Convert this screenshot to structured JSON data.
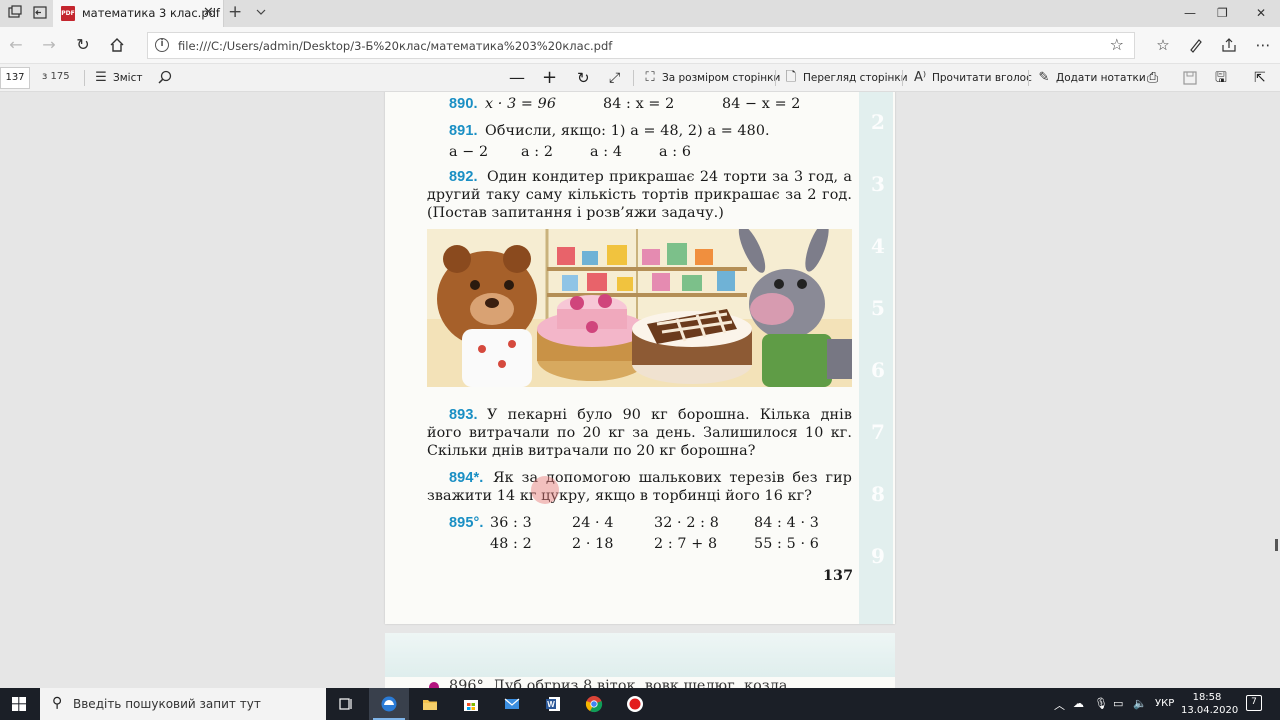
{
  "window": {
    "tab_title": "математика 3 клас.pdf",
    "pdf_badge": "PDF",
    "close_glyph": "✕",
    "new_tab_glyph": "+",
    "minimize_glyph": "—",
    "restore_glyph": "❐",
    "window_close_glyph": "✕"
  },
  "address_bar": {
    "url": "file:///C:/Users/admin/Desktop/3-Б%20клас/математика%203%20клас.pdf"
  },
  "pdf_toolbar": {
    "page_current": "137",
    "page_total": "з 175",
    "contents_label": "Зміст",
    "fit_label": "За розміром сторінки",
    "page_view_label": "Перегляд сторінки",
    "read_aloud_label": "Прочитати вголос",
    "add_notes_label": "Додати нотатки"
  },
  "page": {
    "p890_num": "890.",
    "p890_a": "x · 3 = 96",
    "p890_b": "84 : x = 2",
    "p890_c": "84 − x = 2",
    "p891_num": "891.",
    "p891_text": "Обчисли, якщо: 1) a = 48, 2) a = 480.",
    "p891_e1": "a − 2",
    "p891_e2": "a : 2",
    "p891_e3": "a : 4",
    "p891_e4": "a : 6",
    "p892_num": "892.",
    "p892_l1": "Один кондитер прикрашає 24 торти за 3 год, а",
    "p892_l2": "другий таку саму кількість тортів прикрашає за 2 год.",
    "p892_l3": "(Постав запитання і розв’яжи задачу.)",
    "p893_num": "893.",
    "p893_l1": "У пекарні було 90 кг борошна. Кілька днів",
    "p893_l2": "його витрачали по 20 кг за день. Залишилося 10 кг.",
    "p893_l3": "Скільки днів витрачали по 20 кг борошна?",
    "p894_num": "894*.",
    "p894_l1": "Як за допомогою шалькових терезів без гир",
    "p894_l2": "зважити 14 кг цукру, якщо в торбинці його 16 кг?",
    "p895_num": "895°.",
    "p895_r1": [
      "36 : 3",
      "24 · 4",
      "32 · 2 : 8",
      "84 : 4 · 3"
    ],
    "p895_r2": [
      "48 : 2",
      "2 · 18",
      "2 : 7 + 8",
      "55 : 5 · 6"
    ],
    "page_number": "137",
    "strip_numbers": [
      "2",
      "3",
      "4",
      "5",
      "6",
      "7",
      "8",
      "9"
    ],
    "next_page_peek": "896°. Дуб обгриз 8 віток, вовк шелюг, козла"
  },
  "taskbar": {
    "search_placeholder": "Введіть пошуковий запит тут",
    "language": "УКР",
    "time": "18:58",
    "date": "13.04.2020",
    "notifications_count": "7"
  },
  "colors": {
    "problem_number": "#1a8fc4",
    "taskbar": "#1b1f27",
    "page_strip": "#e2efee"
  }
}
